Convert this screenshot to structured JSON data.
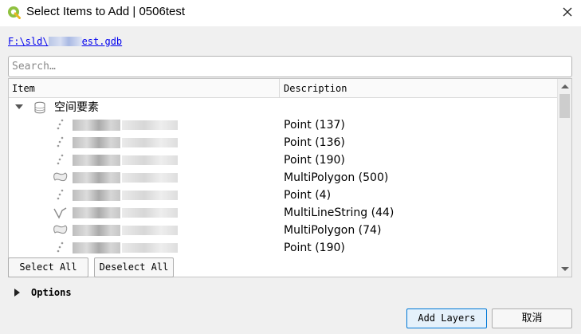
{
  "window": {
    "title": "Select Items to Add | 0506test",
    "app_icon": "qgis-icon",
    "close_icon": "close-icon"
  },
  "path": {
    "prefix": "F:\\sld\\",
    "suffix": "est.gdb"
  },
  "search": {
    "value": "",
    "placeholder": "Search…"
  },
  "tree": {
    "headers": {
      "item": "Item",
      "description": "Description"
    },
    "group": {
      "label": "空间要素",
      "expanded": true,
      "icon": "database-icon"
    },
    "layers": [
      {
        "icon": "point-layer-icon",
        "description": "Point (137)"
      },
      {
        "icon": "point-layer-icon",
        "description": "Point (136)"
      },
      {
        "icon": "point-layer-icon",
        "description": "Point (190)"
      },
      {
        "icon": "polygon-layer-icon",
        "description": "MultiPolygon (500)"
      },
      {
        "icon": "point-layer-icon",
        "description": "Point (4)"
      },
      {
        "icon": "line-layer-icon",
        "description": "MultiLineString (44)"
      },
      {
        "icon": "polygon-layer-icon",
        "description": "MultiPolygon (74)"
      },
      {
        "icon": "point-layer-icon",
        "description": "Point (190)"
      }
    ]
  },
  "buttons": {
    "select_all": "Select All",
    "deselect_all": "Deselect All",
    "add_layers": "Add Layers",
    "cancel": "取消"
  },
  "options": {
    "label": "Options",
    "expanded": false
  },
  "colors": {
    "link": "#0000ee",
    "accent_border": "#0078d7",
    "qgis_green": "#8fc13f"
  }
}
